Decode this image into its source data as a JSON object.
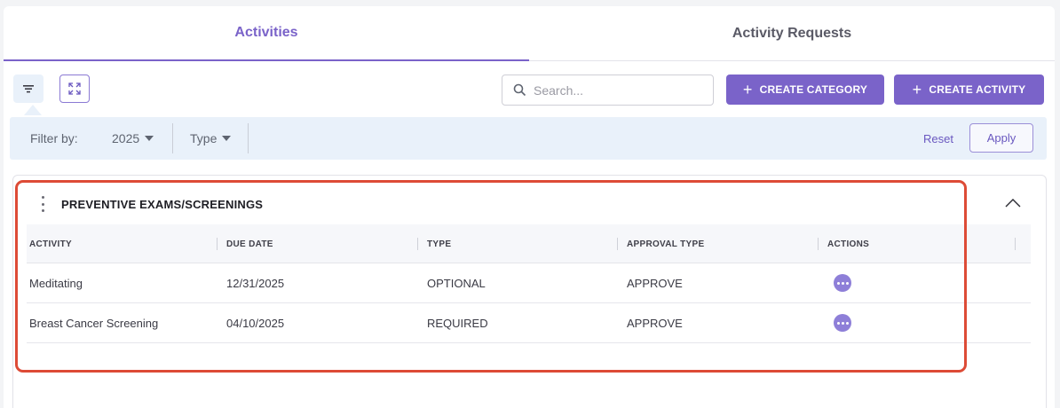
{
  "tabs": [
    {
      "label": "Activities",
      "active": true
    },
    {
      "label": "Activity Requests",
      "active": false
    }
  ],
  "toolbar": {
    "filter_icon": "filter-icon",
    "expand_icon": "expand-icon",
    "search_placeholder": "Search...",
    "create_category_label": "CREATE CATEGORY",
    "create_activity_label": "CREATE ACTIVITY"
  },
  "filter_bar": {
    "label": "Filter by:",
    "year": "2025",
    "type": "Type",
    "reset_label": "Reset",
    "apply_label": "Apply"
  },
  "section": {
    "title": "PREVENTIVE EXAMS/SCREENINGS",
    "columns": [
      "ACTIVITY",
      "DUE DATE",
      "TYPE",
      "APPROVAL TYPE",
      "ACTIONS"
    ],
    "rows": [
      {
        "activity": "Meditating",
        "due_date": "12/31/2025",
        "type": "OPTIONAL",
        "approval_type": "APPROVE"
      },
      {
        "activity": "Breast Cancer Screening",
        "due_date": "04/10/2025",
        "type": "REQUIRED",
        "approval_type": "APPROVE"
      }
    ]
  },
  "colors": {
    "accent": "#7a63c9",
    "highlight": "#dd4b36",
    "filter_bar_bg": "#e9f1fa",
    "action_dot": "#8e7fd8"
  }
}
